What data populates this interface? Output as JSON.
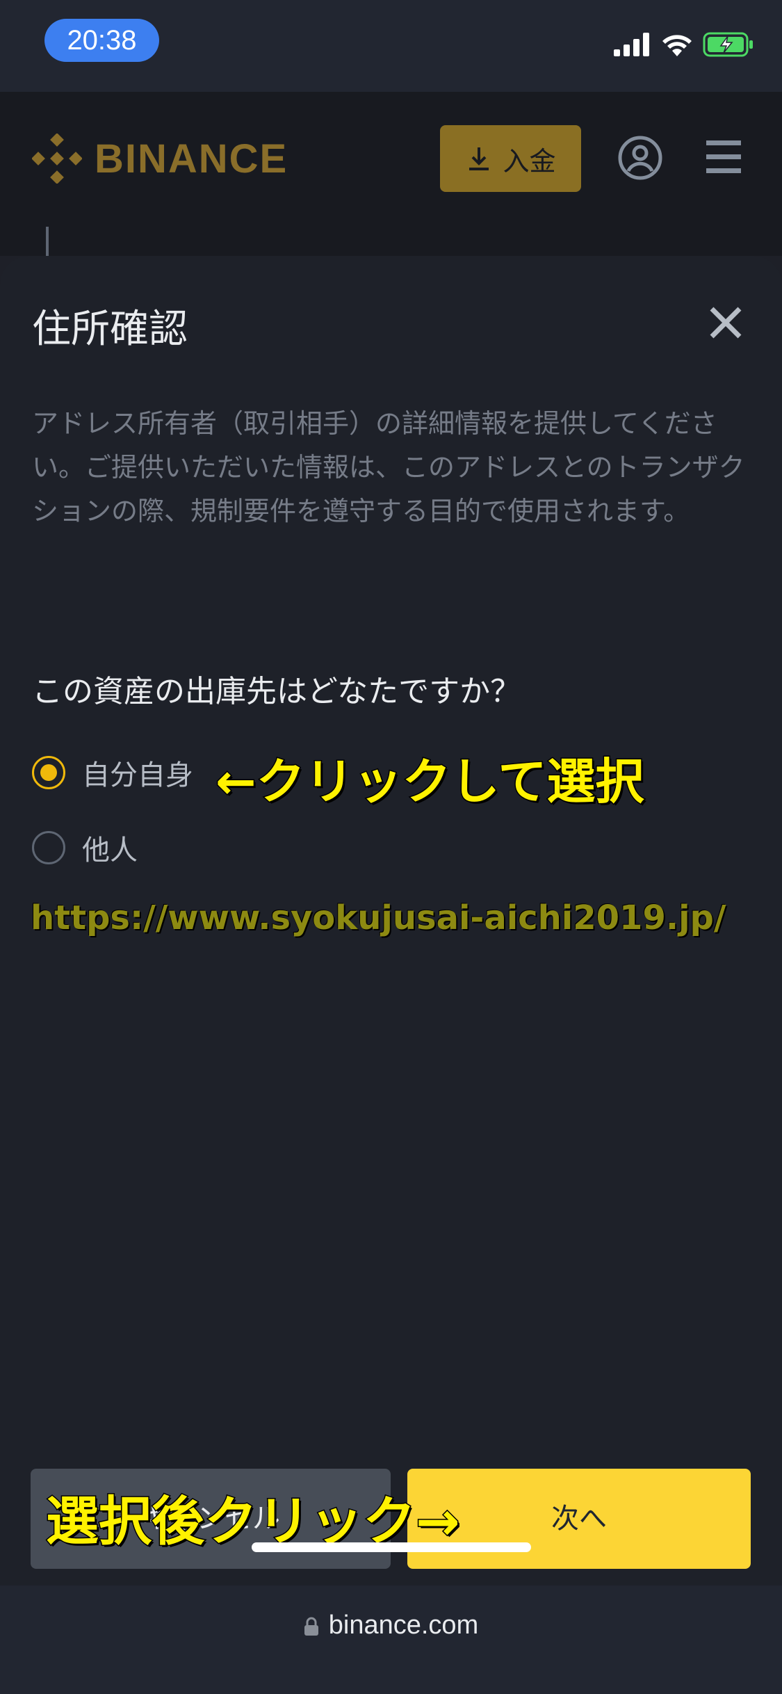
{
  "status_bar": {
    "time": "20:38"
  },
  "header": {
    "logo_text": "BINANCE",
    "deposit_label": "入金"
  },
  "modal": {
    "title": "住所確認",
    "description": "アドレス所有者（取引相手）の詳細情報を提供してください。ご提供いただいた情報は、このアドレスとのトランザクションの際、規制要件を遵守する目的で使用されます。",
    "question": "この資産の出庫先はどなたですか？",
    "options": [
      {
        "label": "自分自身",
        "selected": true
      },
      {
        "label": "他人",
        "selected": false
      }
    ],
    "cancel_label": "キャンセル",
    "next_label": "次へ"
  },
  "annotations": {
    "click_to_select": "←クリックして選択",
    "click_after_select": "選択後クリック→",
    "watermark_url": "https://www.syokujusai-aichi2019.jp/"
  },
  "browser": {
    "domain": "binance.com"
  },
  "colors": {
    "accent": "#fcd535",
    "brand": "#f0b90b",
    "background": "#1e2129"
  }
}
